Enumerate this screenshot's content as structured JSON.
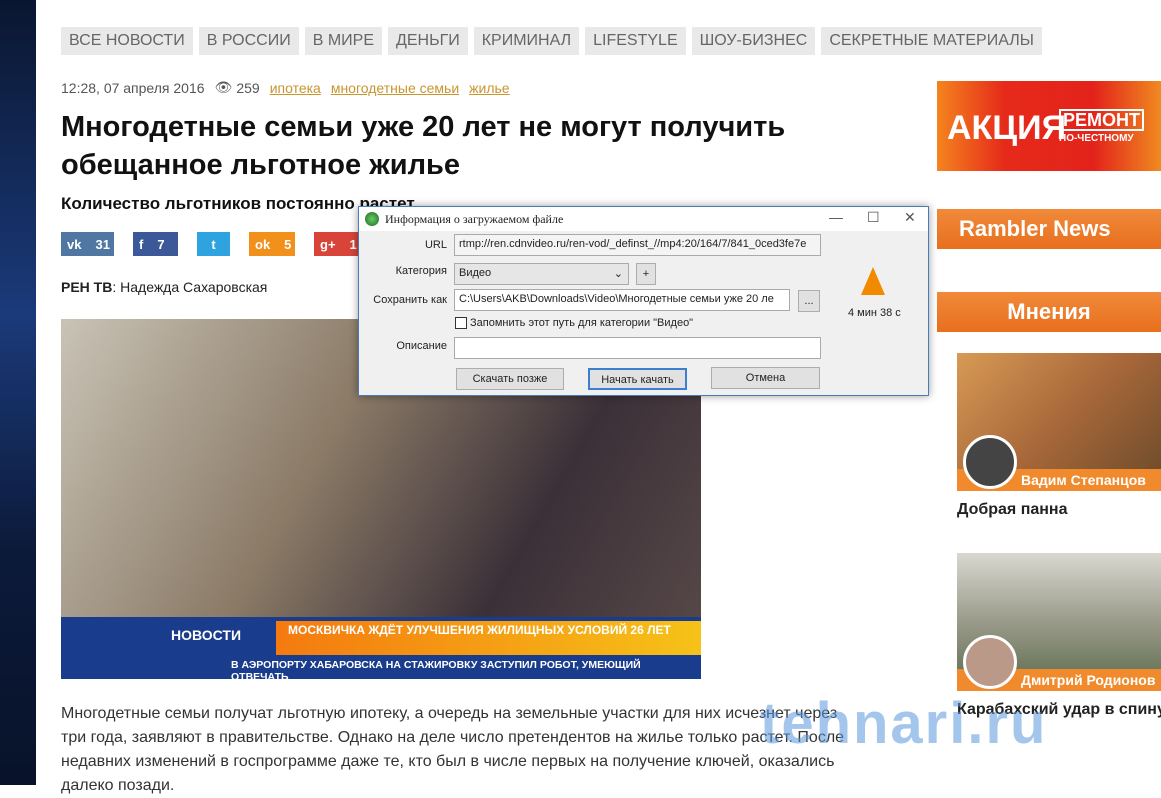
{
  "nav": [
    "ВСЕ НОВОСТИ",
    "В РОССИИ",
    "В МИРЕ",
    "ДЕНЬГИ",
    "КРИМИНАЛ",
    "LIFESTYLE",
    "ШОУ-БИЗНЕС",
    "СЕКРЕТНЫЕ МАТЕРИАЛЫ"
  ],
  "article": {
    "datetime": "12:28, 07 апреля 2016",
    "views": "259",
    "tags": [
      "ипотека",
      "многодетные семьи",
      "жилье"
    ],
    "title": "Многодетные семьи уже 20 лет не могут получить обещанное льготное жилье",
    "subtitle": "Количество льготников постоянно растет",
    "share": [
      {
        "net": "vk",
        "label": "vk",
        "count": "31",
        "color": "#4f77a2"
      },
      {
        "net": "facebook",
        "label": "f",
        "count": "7",
        "color": "#3b5998"
      },
      {
        "net": "twitter",
        "label": "t",
        "count": "",
        "color": "#2fa3e0"
      },
      {
        "net": "odnoklassniki",
        "label": "ok",
        "count": "5",
        "color": "#f2901c"
      },
      {
        "net": "googleplus",
        "label": "g+",
        "count": "1",
        "color": "#d8443a"
      }
    ],
    "author_source": "РЕН ТВ",
    "author_name": ": Надежда Сахаровская",
    "video": {
      "brand": "НОВОСТИ",
      "headline": "МОСКВИЧКА ЖДЁТ УЛУЧШЕНИЯ ЖИЛИЩНЫХ УСЛОВИЙ 26 ЛЕТ",
      "ticker": "В АЭРОПОРТУ ХАБАРОВСКА НА СТАЖИРОВКУ ЗАСТУПИЛ РОБОТ, УМЕЮЩИЙ ОТВЕЧАТЬ"
    },
    "body": "Многодетные семьи получат льготную ипотеку, а очередь на земельные участки для них исчезнет через три года, заявляют в правительстве. Однако на деле число претендентов на жилье только растет. После недавних изменений в госпрограмме даже те, кто был в числе первых на получение ключей, оказались далеко позади."
  },
  "sidebar": {
    "ad": {
      "a": "АКЦИЯ",
      "b": "РЕМОНТ",
      "c": "ПО-ЧЕСТНОМУ"
    },
    "rambler": "Rambler News Servi",
    "opinions": "Мнения",
    "cards": [
      {
        "author": "Вадим Степанцов",
        "title": "Добрая панна"
      },
      {
        "author": "Дмитрий Родионов",
        "title": "Карабахский удар в спину"
      }
    ]
  },
  "watermark": "tehnari.ru",
  "dialog": {
    "title": "Информация о загружаемом файле",
    "url_label": "URL",
    "url": "rtmp://ren.cdnvideo.ru/ren-vod/_definst_//mp4:20/164/7/841_0ced3fe7e",
    "category_label": "Категория",
    "category": "Видео",
    "add": "+",
    "save_label": "Сохранить как",
    "save_path": "C:\\Users\\AKB\\Downloads\\Video\\Многодетные семьи уже 20 ле",
    "browse": "...",
    "remember": "Запомнить этот путь для категории \"Видео\"",
    "desc_label": "Описание",
    "desc": "",
    "duration": "4 мин 38 с",
    "later": "Скачать позже",
    "start": "Начать качать",
    "cancel": "Отмена"
  }
}
